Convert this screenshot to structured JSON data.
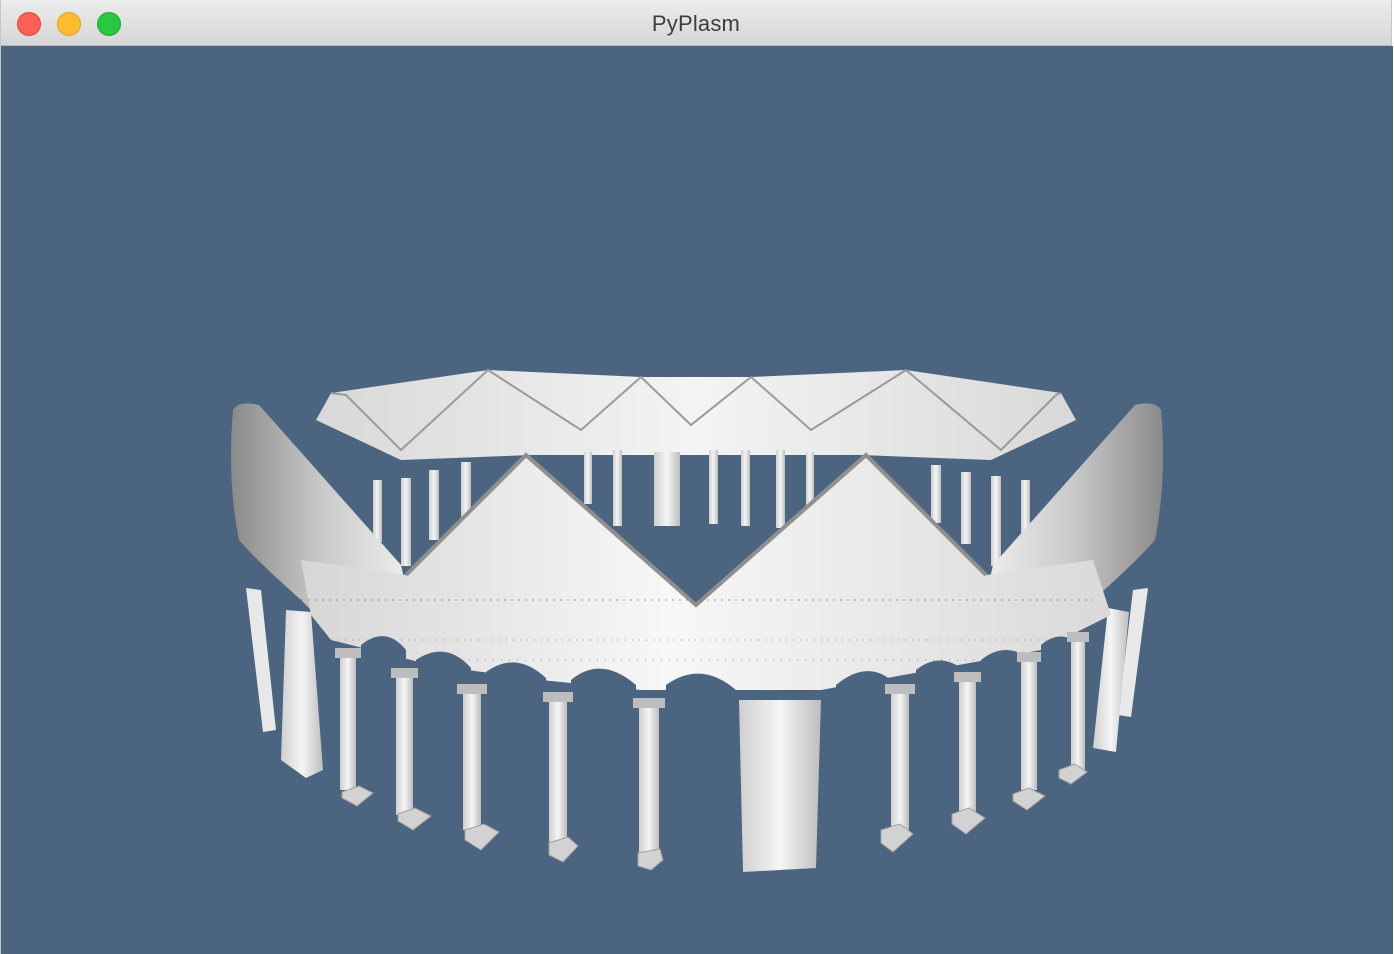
{
  "window": {
    "title": "PyPlasm"
  },
  "controls": {
    "close": "close-button",
    "minimize": "minimize-button",
    "maximize": "maximize-button"
  },
  "viewport": {
    "background_color": "#4b6480",
    "model_color": "#f0f0f0",
    "scene": "colonnade-ring"
  }
}
